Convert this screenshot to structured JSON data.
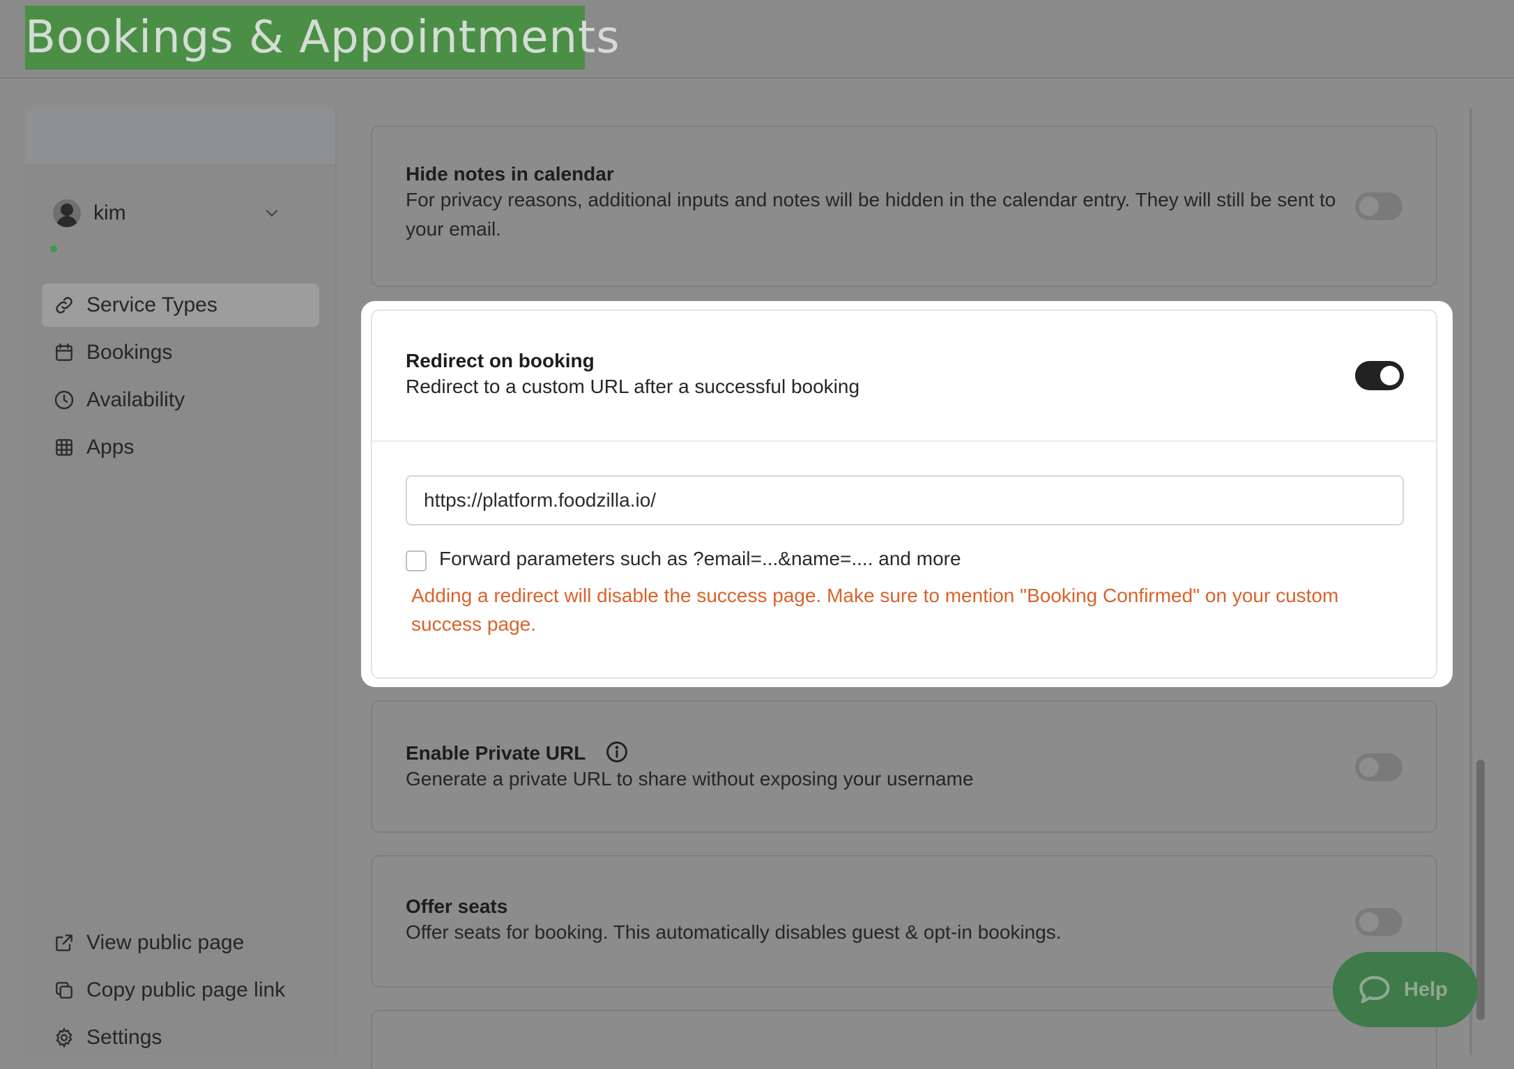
{
  "header": {
    "title": "Bookings & Appointments"
  },
  "user": {
    "name": "kim"
  },
  "sidebar": {
    "items": [
      {
        "label": "Service Types",
        "icon": "link-icon",
        "active": true
      },
      {
        "label": "Bookings",
        "icon": "calendar-icon"
      },
      {
        "label": "Availability",
        "icon": "clock-icon"
      },
      {
        "label": "Apps",
        "icon": "grid-icon"
      }
    ],
    "bottom_items": [
      {
        "label": "View public page",
        "icon": "external-link-icon"
      },
      {
        "label": "Copy public page link",
        "icon": "copy-icon"
      },
      {
        "label": "Settings",
        "icon": "gear-icon"
      }
    ]
  },
  "settings": {
    "hide_notes": {
      "title": "Hide notes in calendar",
      "description": "For privacy reasons, additional inputs and notes will be hidden in the calendar entry. They will still be sent to your email.",
      "enabled": false
    },
    "redirect": {
      "title": "Redirect on booking",
      "description": "Redirect to a custom URL after a successful booking",
      "enabled": true,
      "url_value": "https://platform.foodzilla.io/",
      "forward_params_label": "Forward parameters such as ?email=...&name=.... and more",
      "forward_params_checked": false,
      "warning": "Adding a redirect will disable the success page. Make sure to mention \"Booking Confirmed\" on your custom success page."
    },
    "private_url": {
      "title": "Enable Private URL",
      "description": "Generate a private URL to share without exposing your username",
      "enabled": false
    },
    "offer_seats": {
      "title": "Offer seats",
      "description": "Offer seats for booking. This automatically disables guest & opt-in bookings.",
      "enabled": false
    }
  },
  "help": {
    "label": "Help"
  },
  "colors": {
    "brand": "#4b8f47",
    "warning": "#d9622a",
    "toggle_on": "#222222"
  }
}
